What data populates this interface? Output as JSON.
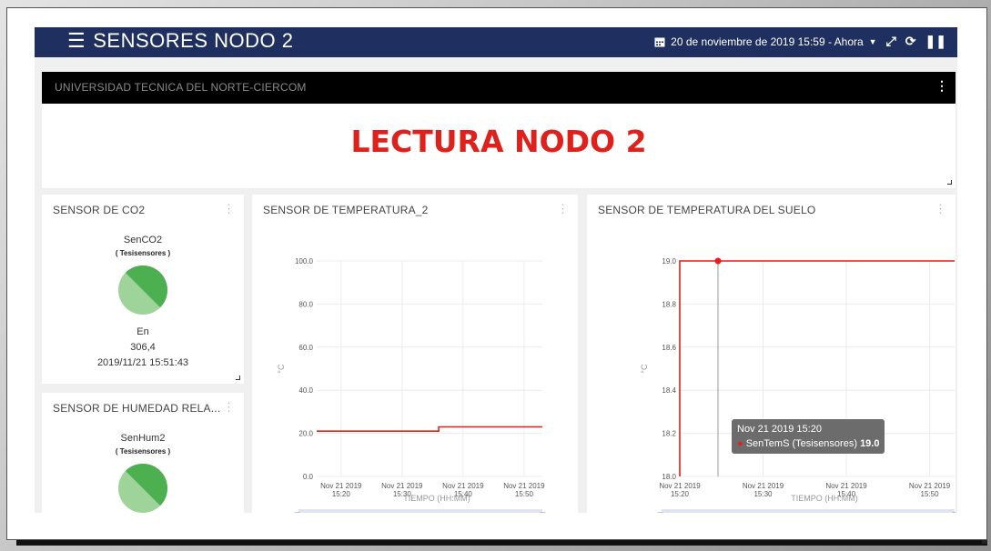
{
  "app": {
    "title": "SENSORES NODO 2",
    "date_range": "20 de noviembre de 2019 15:59 - Ahora",
    "icons": [
      "menu-icon",
      "calendar-icon",
      "caret-down-icon",
      "expand-icon",
      "refresh-icon",
      "pause-icon"
    ]
  },
  "header_panel": {
    "title": "UNIVERSIDAD TECNICA DEL NORTE-CIERCOM"
  },
  "banner": {
    "text": "LECTURA NODO 2",
    "color": "#e0201a"
  },
  "co2_card": {
    "title": "SENSOR DE CO2",
    "sensor_name": "SenCO2",
    "sensor_group": "( Tesisensores )",
    "state": "En",
    "value": "306,4",
    "timestamp": "2019/11/21 15:51:43"
  },
  "humidity_card": {
    "title": "SENSOR DE HUMEDAD RELA...",
    "sensor_name": "SenHum2",
    "sensor_group": "( Tesisensores )"
  },
  "temp_card": {
    "title": "SENSOR DE TEMPERATURA_2"
  },
  "soil_card": {
    "title": "SENSOR DE TEMPERATURA DEL SUELO",
    "tooltip": {
      "time": "Nov 21 2019 15:20",
      "series": "SenTemS (Tesisensores)",
      "value": "19.0"
    }
  },
  "colors": {
    "topbar": "#1f3060",
    "line": "#e0201a",
    "gauge": "#4caf50"
  },
  "chart_data": [
    {
      "type": "line",
      "title": "SENSOR DE TEMPERATURA_2",
      "xlabel": "TIEMPO (HH:MM)",
      "ylabel": "°C",
      "yticks": [
        "100.0",
        "80.0",
        "60.0",
        "40.0",
        "20.0",
        "0.0"
      ],
      "ylim": [
        0,
        100
      ],
      "xticks": [
        [
          "Nov 21 2019",
          "15:20"
        ],
        [
          "Nov 21 2019",
          "15:30"
        ],
        [
          "Nov 21 2019",
          "15:40"
        ],
        [
          "Nov 21 2019",
          "15:50"
        ]
      ],
      "x_domain": [
        "15:16",
        "15:53"
      ],
      "grid": true,
      "series": [
        {
          "x": [
            "15:16",
            "15:36",
            "15:36",
            "15:53"
          ],
          "y": [
            21,
            21,
            23,
            23
          ]
        }
      ]
    },
    {
      "type": "line",
      "title": "SENSOR DE TEMPERATURA DEL SUELO",
      "xlabel": "TIEMPO (HH:MM)",
      "ylabel": "°C",
      "yticks": [
        "19.0",
        "18.8",
        "18.6",
        "18.4",
        "18.2",
        "18.0"
      ],
      "ylim": [
        18.0,
        19.0
      ],
      "xticks": [
        [
          "Nov 21 2019",
          "15:20"
        ],
        [
          "Nov 21 2019",
          "15:30"
        ],
        [
          "Nov 21 2019",
          "15:40"
        ],
        [
          "Nov 21 2019",
          "15:50"
        ]
      ],
      "x_domain": [
        "15:20",
        "15:53"
      ],
      "grid": true,
      "series": [
        {
          "name": "SenTemS (Tesisensores)",
          "x": [
            "15:20",
            "15:20",
            "15:53"
          ],
          "y": [
            18.0,
            19.0,
            19.0
          ]
        }
      ]
    }
  ]
}
